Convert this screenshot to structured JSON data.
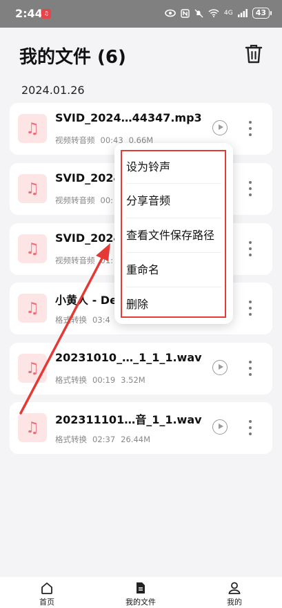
{
  "status_bar": {
    "time": "2:44",
    "app_badge": "ꜛ",
    "network_label": "4G",
    "battery": "43"
  },
  "header": {
    "title": "我的文件 (6)"
  },
  "date_group": "2024.01.26",
  "files": [
    {
      "name": "SVID_2024…44347.mp3",
      "type": "视频转音频",
      "duration": "00:43",
      "size": "0.66M"
    },
    {
      "name": "SVID_2024",
      "type": "视频转音频",
      "duration": "00:",
      "size": ""
    },
    {
      "name": "SVID_2024",
      "type": "视频转音频",
      "duration": "01:",
      "size": ""
    },
    {
      "name": "小黄人 - De",
      "type": "格式转换",
      "duration": "03:4",
      "size": ""
    },
    {
      "name": "20231010_…_1_1_1.wav",
      "type": "格式转换",
      "duration": "00:19",
      "size": "3.52M"
    },
    {
      "name": "202311101…音_1_1.wav",
      "type": "格式转换",
      "duration": "02:37",
      "size": "26.44M"
    }
  ],
  "context_menu": {
    "items": [
      "设为铃声",
      "分享音频",
      "查看文件保存路径",
      "重命名",
      "删除"
    ]
  },
  "bottom_nav": {
    "items": [
      {
        "label": "首页",
        "icon": "home-icon"
      },
      {
        "label": "我的文件",
        "icon": "file-icon"
      },
      {
        "label": "我的",
        "icon": "person-icon"
      }
    ],
    "active_index": 1
  },
  "colors": {
    "accent_red": "#e53935",
    "file_icon_bg": "#fde5e5",
    "file_icon_fg": "#ef6d78"
  }
}
